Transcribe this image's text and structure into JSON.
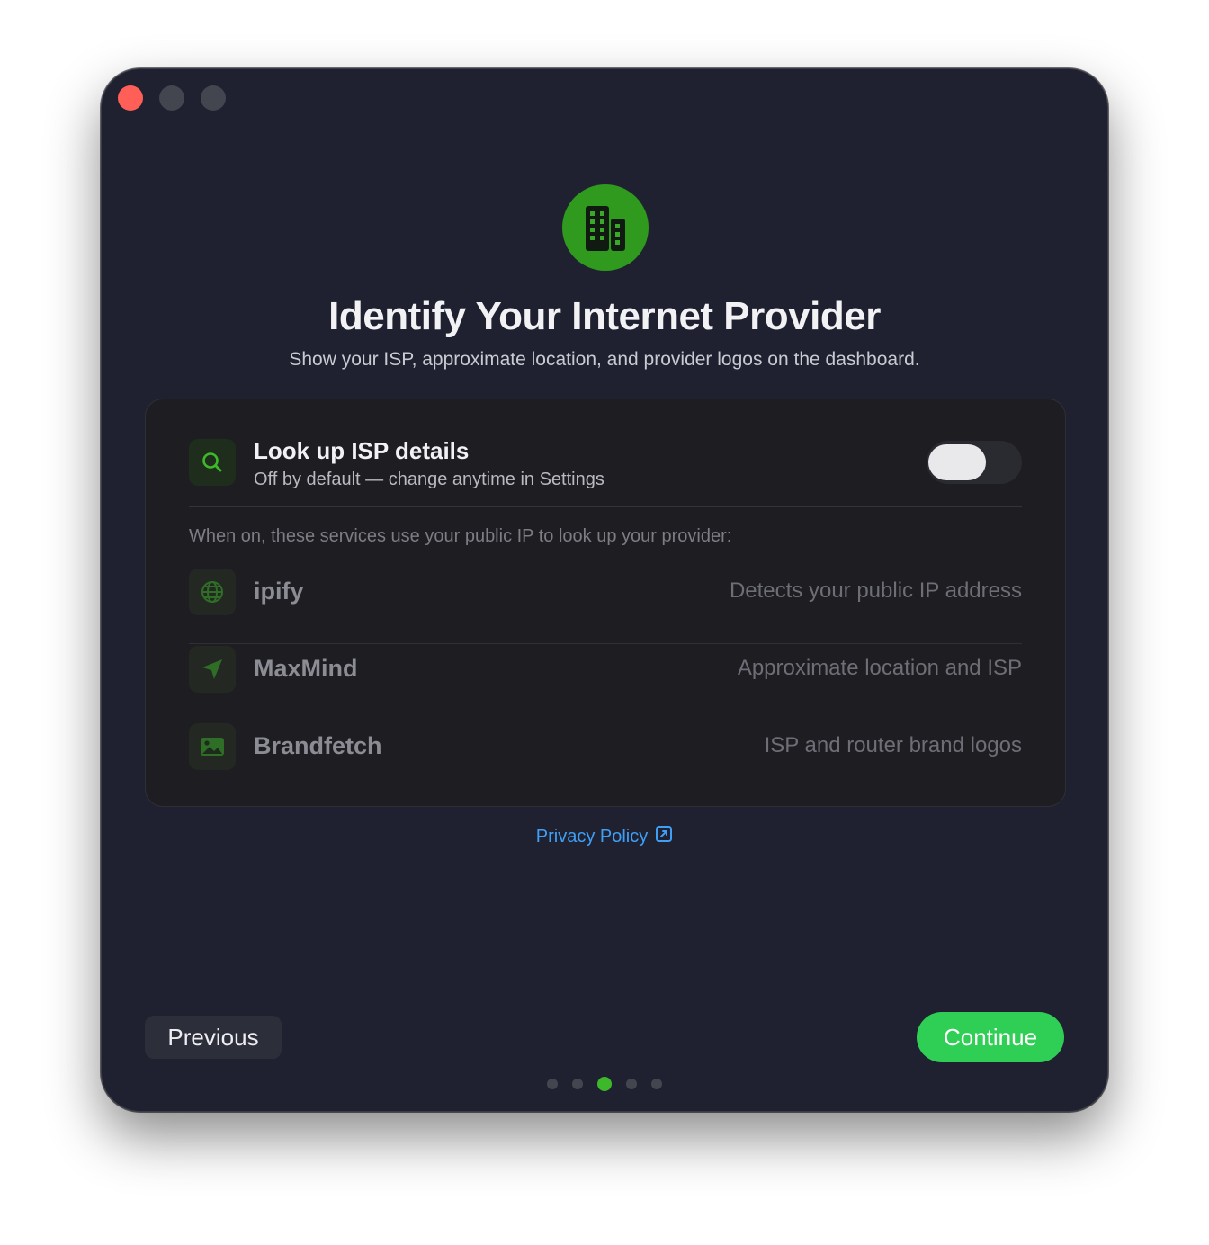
{
  "window": {
    "traffic_lights": [
      "close",
      "minimize",
      "zoom"
    ]
  },
  "hero": {
    "icon": "building-icon",
    "title": "Identify Your Internet Provider",
    "subtitle": "Show your ISP, approximate location, and provider logos on the dashboard."
  },
  "toggle": {
    "icon": "search-icon",
    "title": "Look up ISP details",
    "subtitle": "Off by default — change anytime in Settings",
    "enabled": false
  },
  "services": {
    "note": "When on, these services use your public IP to look up your provider:",
    "items": [
      {
        "name": "ipify",
        "description": "Detects your public IP address",
        "icon": "globe-icon"
      },
      {
        "name": "MaxMind",
        "description": "Approximate location and ISP",
        "icon": "location-arrow-icon"
      },
      {
        "name": "Brandfetch",
        "description": "ISP and router brand logos",
        "icon": "image-icon"
      }
    ]
  },
  "links": {
    "privacy_policy": "Privacy Policy",
    "privacy_icon": "external-link-icon"
  },
  "footer": {
    "previous_label": "Previous",
    "continue_label": "Continue",
    "page_index": 3,
    "page_count": 5
  },
  "colors": {
    "window_bg": "#1f2130",
    "accent_green": "#2fcf55",
    "link_blue": "#3f9ef5",
    "close_red": "#ff5f57"
  }
}
